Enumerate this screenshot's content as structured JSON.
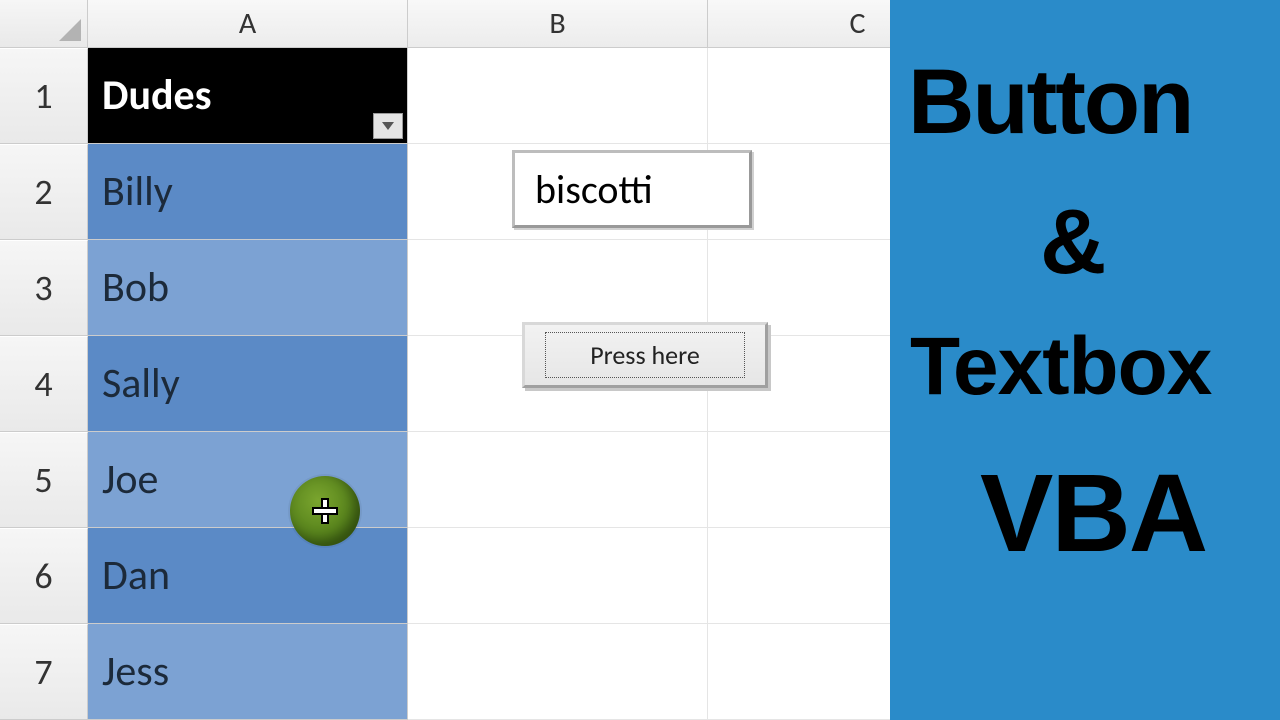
{
  "columns": {
    "A": "A",
    "B": "B",
    "C": "C"
  },
  "row_numbers": [
    "1",
    "2",
    "3",
    "4",
    "5",
    "6",
    "7"
  ],
  "table": {
    "header": "Dudes",
    "rows": [
      "Billy",
      "Bob",
      "Sally",
      "Joe",
      "Dan",
      "Jess"
    ]
  },
  "controls": {
    "textbox_value": "biscotti",
    "button_label": "Press here"
  },
  "overlay": {
    "line1": "Button",
    "line2": "&",
    "line3": "Textbox",
    "line4": "VBA"
  }
}
